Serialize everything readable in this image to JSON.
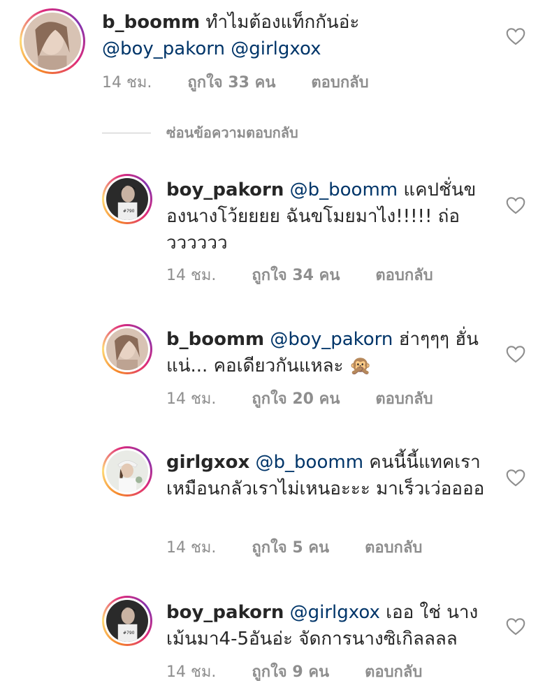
{
  "hide_replies_label": "ซ่อนข้อความตอบกลับ",
  "colors": {
    "text": "#262626",
    "meta": "#8e8e8e",
    "mention": "#003569",
    "ring": "instagram-gradient"
  },
  "comments": [
    {
      "username": "b_boomm",
      "text_pre": " ทำไมต้องแท็กกันอ่ะ ",
      "mentions": [
        "@boy_pakorn",
        "@girlgxox"
      ],
      "text_post": "",
      "time": "14 ชม.",
      "likes": "ถูกใจ 33 คน",
      "reply": "ตอบกลับ",
      "avatar": "avatar-b_boomm",
      "icon": "heart-icon"
    },
    {
      "username": "boy_pakorn",
      "text_pre": " ",
      "mentions": [
        "@b_boomm"
      ],
      "text_post": " แคปชั่นของนางโว้ยยยย ฉันขโมยมาไง!!!!! ถ่อวววววว",
      "time": "14 ชม.",
      "likes": "ถูกใจ 34 คน",
      "reply": "ตอบกลับ",
      "avatar": "avatar-boy_pakorn",
      "icon": "heart-icon"
    },
    {
      "username": "b_boomm",
      "text_pre": " ",
      "mentions": [
        "@boy_pakorn"
      ],
      "text_post": " ฮ่าๆๆๆ ฮั่นแน่... คอเดียวกันแหละ 🙊",
      "time": "14 ชม.",
      "likes": "ถูกใจ 20 คน",
      "reply": "ตอบกลับ",
      "avatar": "avatar-b_boomm",
      "icon": "heart-icon"
    },
    {
      "username": "girlgxox",
      "text_pre": " ",
      "mentions": [
        "@b_boomm"
      ],
      "text_post": " คนนี้นี้แทคเรา เหมือนกลัวเราไม่เหนอะะะ มาเร็วเว่ออออ",
      "time": "14 ชม.",
      "likes": "ถูกใจ 5 คน",
      "reply": "ตอบกลับ",
      "avatar": "avatar-girlgxox",
      "icon": "heart-icon"
    },
    {
      "username": "boy_pakorn",
      "text_pre": " ",
      "mentions": [
        "@girlgxox"
      ],
      "text_post": " เออ ใช่ นางเม้นมา4-5อันอ่ะ จัดการนางซิเกิลลลล",
      "time": "14 ชม.",
      "likes": "ถูกใจ 9 คน",
      "reply": "ตอบกลับ",
      "avatar": "avatar-boy_pakorn",
      "icon": "heart-icon"
    }
  ]
}
